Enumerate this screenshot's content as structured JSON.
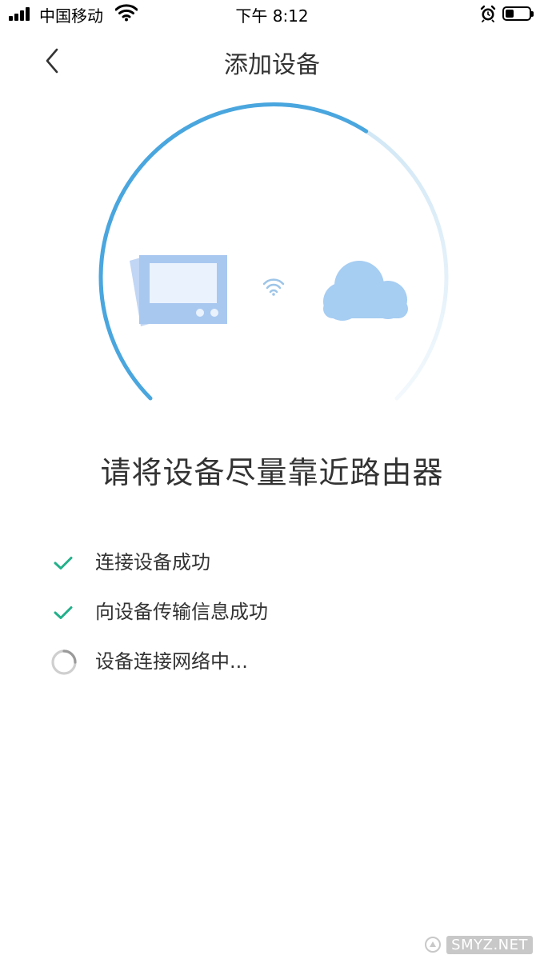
{
  "status_bar": {
    "carrier": "中国移动",
    "time": "下午 8:12",
    "battery_level": 0.35
  },
  "nav": {
    "title": "添加设备"
  },
  "connection_progress": 0.62,
  "instruction": "请将设备尽量靠近路由器",
  "steps": [
    {
      "label": "连接设备成功",
      "status": "done"
    },
    {
      "label": "向设备传输信息成功",
      "status": "done"
    },
    {
      "label": "设备连接网络中...",
      "status": "in-progress"
    }
  ],
  "colors": {
    "accent_blue": "#4aa6de",
    "check_green": "#23b08a",
    "device_blue": "#a9c8f0",
    "cloud_blue": "#a6cdf2",
    "text_dark": "#333333"
  },
  "watermark": "SMYZ.NET"
}
